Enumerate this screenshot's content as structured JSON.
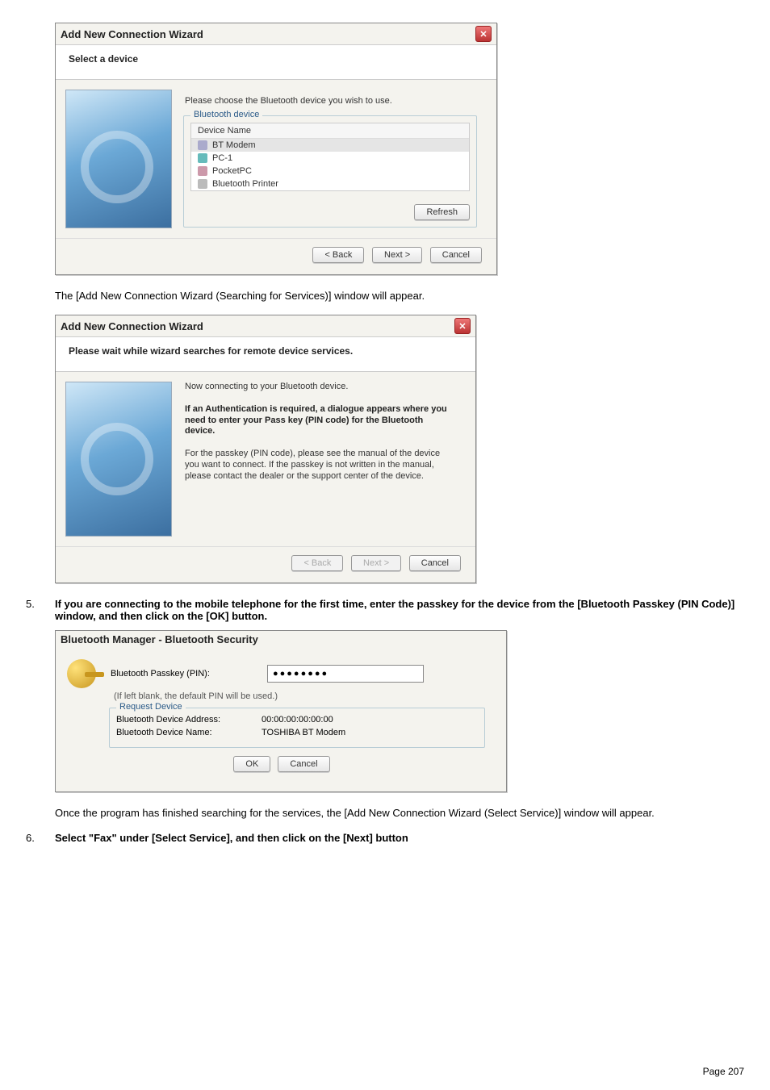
{
  "dialog1": {
    "title": "Add New Connection Wizard",
    "header": "Select a device",
    "prompt": "Please choose the Bluetooth device you wish to use.",
    "fieldset_legend": "Bluetooth device",
    "column_header": "Device Name",
    "devices": [
      "BT Modem",
      "PC-1",
      "PocketPC",
      "Bluetooth Printer"
    ],
    "refresh": "Refresh",
    "back": "< Back",
    "next": "Next >",
    "cancel": "Cancel"
  },
  "text1": "The [Add New Connection Wizard (Searching for Services)] window will appear.",
  "dialog2": {
    "title": "Add New Connection Wizard",
    "header": "Please wait while wizard searches for remote device services.",
    "line1": "Now connecting to your Bluetooth device.",
    "line2": "If an Authentication is required, a dialogue appears where you need to enter your Pass key (PIN code) for the Bluetooth device.",
    "line3": "For the passkey (PIN code), please see the manual of the device you want to connect. If the passkey is not written in the manual, please contact the dealer or the support center of the device.",
    "back": "< Back",
    "next": "Next >",
    "cancel": "Cancel"
  },
  "step5": {
    "num": "5.",
    "text": "If you are connecting to the mobile telephone for the first time, enter the passkey for the device from the [Bluetooth Passkey (PIN Code)] window, and then click on the [OK] button."
  },
  "dialog3": {
    "title": "Bluetooth Manager - Bluetooth Security",
    "pin_label": "Bluetooth Passkey (PIN):",
    "pin_value": "●●●●●●●●",
    "hint": "(If left blank, the default PIN will be used.)",
    "group_legend": "Request Device",
    "addr_label": "Bluetooth Device Address:",
    "addr_value": "00:00:00:00:00:00",
    "name_label": "Bluetooth Device Name:",
    "name_value": "TOSHIBA BT Modem",
    "ok": "OK",
    "cancel": "Cancel"
  },
  "text2": "Once the program has finished searching for the services, the [Add New Connection Wizard (Select Service)] window will appear.",
  "step6": {
    "num": "6.",
    "text": "Select \"Fax\" under [Select Service], and then click on the [Next] button"
  },
  "page_label": "Page 207"
}
